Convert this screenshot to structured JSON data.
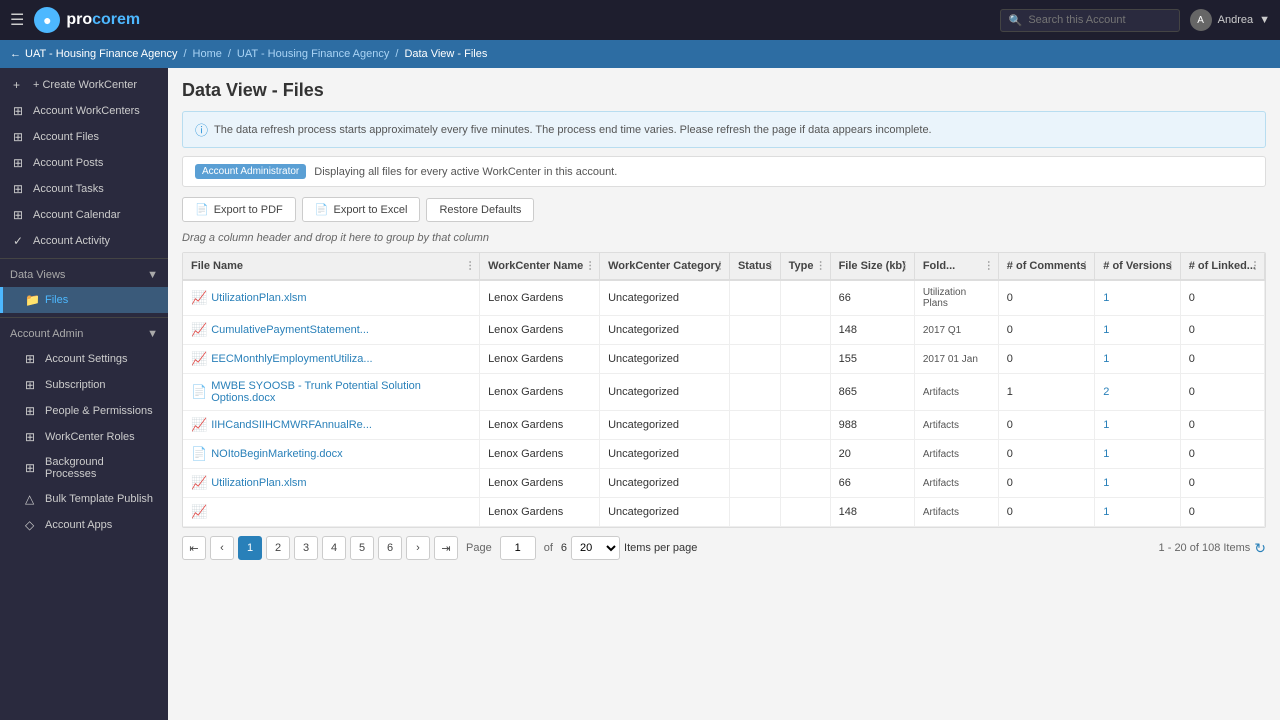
{
  "app": {
    "logo_text": "procorem",
    "logo_accent": "m"
  },
  "topnav": {
    "search_placeholder": "Search this Account",
    "user_name": "Andrea",
    "user_initials": "A"
  },
  "breadcrumb": {
    "back_label": "UAT - Housing Finance Agency",
    "home": "Home",
    "parent": "UAT - Housing Finance Agency",
    "current": "Data View - Files"
  },
  "sidebar": {
    "create_label": "+ Create WorkCenter",
    "items": [
      {
        "id": "account-workcenters",
        "label": "Account WorkCenters",
        "icon": "⊞"
      },
      {
        "id": "account-files",
        "label": "Account Files",
        "icon": "⊞"
      },
      {
        "id": "account-posts",
        "label": "Account Posts",
        "icon": "⊞"
      },
      {
        "id": "account-tasks",
        "label": "Account Tasks",
        "icon": "⊞"
      },
      {
        "id": "account-calendar",
        "label": "Account Calendar",
        "icon": "⊞"
      },
      {
        "id": "account-activity",
        "label": "Account Activity",
        "icon": "⊞"
      }
    ],
    "data_views": {
      "label": "Data Views",
      "children": [
        {
          "id": "files",
          "label": "Files",
          "icon": "📁"
        }
      ]
    },
    "account_admin": {
      "label": "Account Admin",
      "children": [
        {
          "id": "account-settings",
          "label": "Account Settings",
          "icon": "⊞"
        },
        {
          "id": "subscription",
          "label": "Subscription",
          "icon": "⊞"
        },
        {
          "id": "people-permissions",
          "label": "People & Permissions",
          "icon": "⊞"
        },
        {
          "id": "workcenter-roles",
          "label": "WorkCenter Roles",
          "icon": "⊞"
        },
        {
          "id": "background-processes",
          "label": "Background Processes",
          "icon": "⊞"
        },
        {
          "id": "bulk-template-publish",
          "label": "Bulk Template Publish",
          "icon": "⊞"
        },
        {
          "id": "account-apps",
          "label": "Account Apps",
          "icon": "⊞"
        }
      ]
    }
  },
  "page": {
    "title": "Data View - Files",
    "info_message": "The data refresh process starts approximately every five minutes. The process end time varies. Please refresh the page if data appears incomplete.",
    "admin_badge": "Account Administrator",
    "admin_message": "Displaying all files for every active WorkCenter in this account.",
    "drag_hint": "Drag a column header and drop it here to group by that column"
  },
  "toolbar": {
    "export_pdf": "Export to PDF",
    "export_excel": "Export to Excel",
    "restore_defaults": "Restore Defaults"
  },
  "table": {
    "columns": [
      "File Name",
      "WorkCenter Name",
      "WorkCenter Category",
      "Status",
      "Type",
      "File Size (kb)",
      "Fold...",
      "# of Comments",
      "# of Versions",
      "# of Linked..."
    ],
    "rows": [
      {
        "file_name": "UtilizationPlan.xlsm",
        "file_type_icon": "xlsx",
        "workcenter": "Lenox Gardens",
        "category": "Uncategorized",
        "status": "",
        "type": "",
        "file_size": "66",
        "folder": "Utilization Plans",
        "comments": "0",
        "versions": "1",
        "linked": "0"
      },
      {
        "file_name": "CumulativePaymentStatement...",
        "file_type_icon": "xlsx",
        "workcenter": "Lenox Gardens",
        "category": "Uncategorized",
        "status": "",
        "type": "",
        "file_size": "148",
        "folder": "2017 Q1",
        "comments": "0",
        "versions": "1",
        "linked": "0"
      },
      {
        "file_name": "EECMonthlyEmploymentUtiliza...",
        "file_type_icon": "xlsx",
        "workcenter": "Lenox Gardens",
        "category": "Uncategorized",
        "status": "",
        "type": "",
        "file_size": "155",
        "folder": "2017 01 Jan",
        "comments": "0",
        "versions": "1",
        "linked": "0"
      },
      {
        "file_name": "MWBE SYOOSB - Trunk Potential Solution Options.docx",
        "file_type_icon": "docx",
        "workcenter": "Lenox Gardens",
        "category": "Uncategorized",
        "status": "",
        "type": "",
        "file_size": "865",
        "folder": "Artifacts",
        "comments": "1",
        "versions": "2",
        "linked": "0"
      },
      {
        "file_name": "IIHCandSIIHCMWRFAnnualRe...",
        "file_type_icon": "xlsx",
        "workcenter": "Lenox Gardens",
        "category": "Uncategorized",
        "status": "",
        "type": "",
        "file_size": "988",
        "folder": "Artifacts",
        "comments": "0",
        "versions": "1",
        "linked": "0"
      },
      {
        "file_name": "NOItoBeginMarketing.docx",
        "file_type_icon": "docx",
        "workcenter": "Lenox Gardens",
        "category": "Uncategorized",
        "status": "",
        "type": "",
        "file_size": "20",
        "folder": "Artifacts",
        "comments": "0",
        "versions": "1",
        "linked": "0"
      },
      {
        "file_name": "UtilizationPlan.xlsm",
        "file_type_icon": "xlsx",
        "workcenter": "Lenox Gardens",
        "category": "Uncategorized",
        "status": "",
        "type": "",
        "file_size": "66",
        "folder": "Artifacts",
        "comments": "0",
        "versions": "1",
        "linked": "0"
      },
      {
        "file_name": "",
        "file_type_icon": "xlsx",
        "workcenter": "Lenox Gardens",
        "category": "Uncategorized",
        "status": "",
        "type": "",
        "file_size": "148",
        "folder": "Artifacts",
        "comments": "0",
        "versions": "1",
        "linked": "0"
      }
    ]
  },
  "pagination": {
    "pages": [
      "1",
      "2",
      "3",
      "4",
      "5",
      "6"
    ],
    "current_page": "1",
    "page_label": "Page",
    "of_label": "of",
    "total_pages": "6",
    "items_per_page": "20",
    "items_per_page_label": "Items per page",
    "items_count": "1 - 20 of 108 Items"
  }
}
